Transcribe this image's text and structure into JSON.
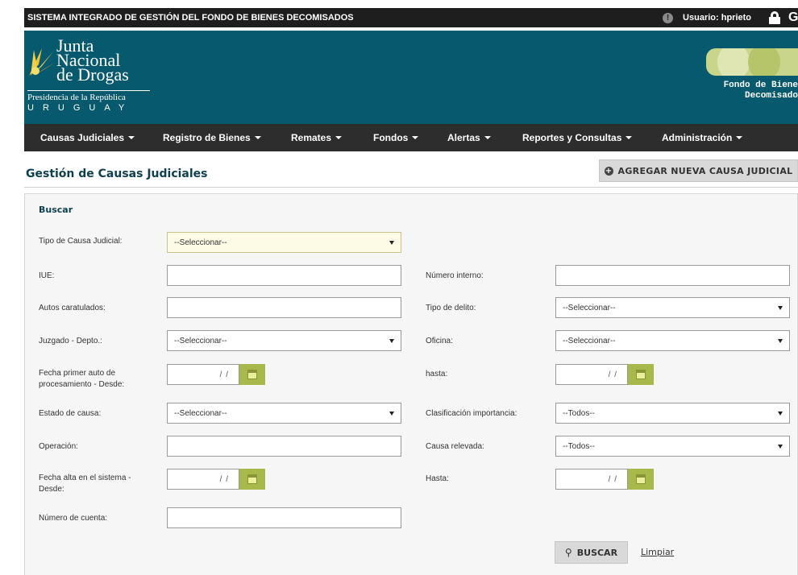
{
  "system_bar": {
    "title": "SISTEMA INTEGRADO DE GESTIÓN DEL FONDO DE BIENES DECOMISADOS",
    "alert_glyph": "!",
    "user": "Usuario: hprieto",
    "logout_glyph": "G"
  },
  "header": {
    "logo_lines": [
      "Junta",
      "Nacional",
      "de Drogas"
    ],
    "presidencia": "Presidencia de la República",
    "uruguay": "URUGUAY",
    "fondo_text": "Fondo de Biene\n    Decomisado"
  },
  "nav": [
    {
      "label": "Causas Judiciales"
    },
    {
      "label": "Registro de Bienes"
    },
    {
      "label": "Remates"
    },
    {
      "label": "Fondos"
    },
    {
      "label": "Alertas"
    },
    {
      "label": "Reportes y Consultas"
    },
    {
      "label": "Administración"
    }
  ],
  "page": {
    "title": "Gestión de Causas Judiciales",
    "add_button": "AGREGAR NUEVA CAUSA JUDICIAL"
  },
  "search": {
    "panel_title": "Buscar",
    "tipo_causa": {
      "label": "Tipo de Causa Judicial:",
      "value": "--Seleccionar--"
    },
    "iue": {
      "label": "IUE:",
      "value": ""
    },
    "numero_interno": {
      "label": "Número interno:",
      "value": ""
    },
    "autos": {
      "label": "Autos caratulados:",
      "value": ""
    },
    "tipo_delito": {
      "label": "Tipo de delito:",
      "value": "--Seleccionar--"
    },
    "juzgado": {
      "label": "Juzgado - Depto.:",
      "value": "--Seleccionar--"
    },
    "oficina": {
      "label": "Oficina:",
      "value": "--Seleccionar--"
    },
    "fecha_auto_desde": {
      "label": "Fecha primer auto de procesamiento - Desde:",
      "value": "/ /"
    },
    "fecha_auto_hasta": {
      "label": "hasta:",
      "value": "/ /"
    },
    "estado": {
      "label": "Estado de causa:",
      "value": "--Seleccionar--"
    },
    "clasificacion": {
      "label": "Clasificación importancia:",
      "value": "--Todos--"
    },
    "operacion": {
      "label": "Operación:",
      "value": ""
    },
    "relevada": {
      "label": "Causa relevada:",
      "value": "--Todos--"
    },
    "fecha_alta_desde": {
      "label": "Fecha alta en el sistema - Desde:",
      "value": "/ /"
    },
    "fecha_alta_hasta": {
      "label": "Hasta:",
      "value": "/ /"
    },
    "numero_cuenta": {
      "label": "Número de cuenta:",
      "value": ""
    },
    "buscar_button": "BUSCAR",
    "limpiar_link": "Limpiar"
  }
}
